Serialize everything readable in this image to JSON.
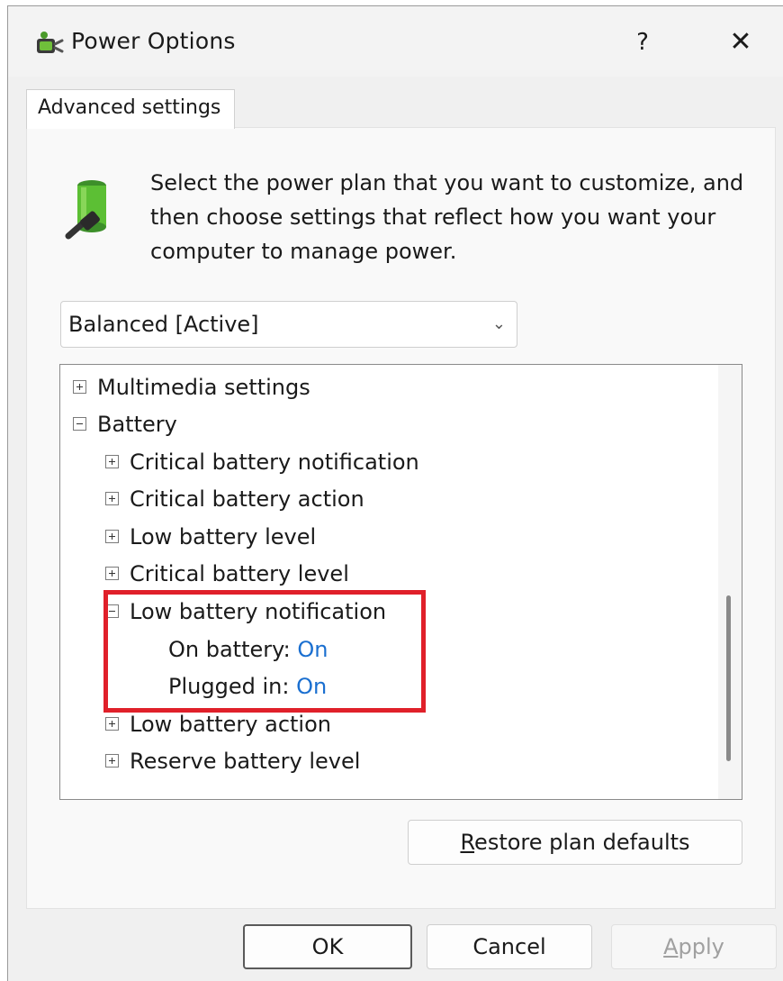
{
  "window": {
    "title": "Power Options",
    "help_label": "?",
    "close_label": "✕",
    "icon": "power-options-icon"
  },
  "tab": {
    "label": "Advanced settings"
  },
  "intro": {
    "icon": "battery-plug-icon",
    "text": "Select the power plan that you want to customize, and then choose settings that reflect how you want your computer to manage power."
  },
  "plan_select": {
    "value": "Balanced [Active]"
  },
  "tree": {
    "items": [
      {
        "label": "Multimedia settings",
        "expander": "plus",
        "level": 0
      },
      {
        "label": "Battery",
        "expander": "minus",
        "level": 0
      },
      {
        "label": "Critical battery notification",
        "expander": "plus",
        "level": 1
      },
      {
        "label": "Critical battery action",
        "expander": "plus",
        "level": 1
      },
      {
        "label": "Low battery level",
        "expander": "plus",
        "level": 1
      },
      {
        "label": "Critical battery level",
        "expander": "plus",
        "level": 1
      },
      {
        "label": "Low battery notification",
        "expander": "minus",
        "level": 1
      },
      {
        "label": "On battery:",
        "value": "On",
        "level": 2
      },
      {
        "label": "Plugged in:",
        "value": "On",
        "level": 2
      },
      {
        "label": "Low battery action",
        "expander": "plus",
        "level": 1
      },
      {
        "label": "Reserve battery level",
        "expander": "plus",
        "level": 1
      }
    ]
  },
  "buttons": {
    "restore_prefix": "R",
    "restore_rest": "estore plan defaults",
    "ok": "OK",
    "cancel": "Cancel",
    "apply_prefix": "A",
    "apply_rest": "pply"
  },
  "colors": {
    "highlight": "#e0202a",
    "value_link": "#1a6fd0"
  }
}
